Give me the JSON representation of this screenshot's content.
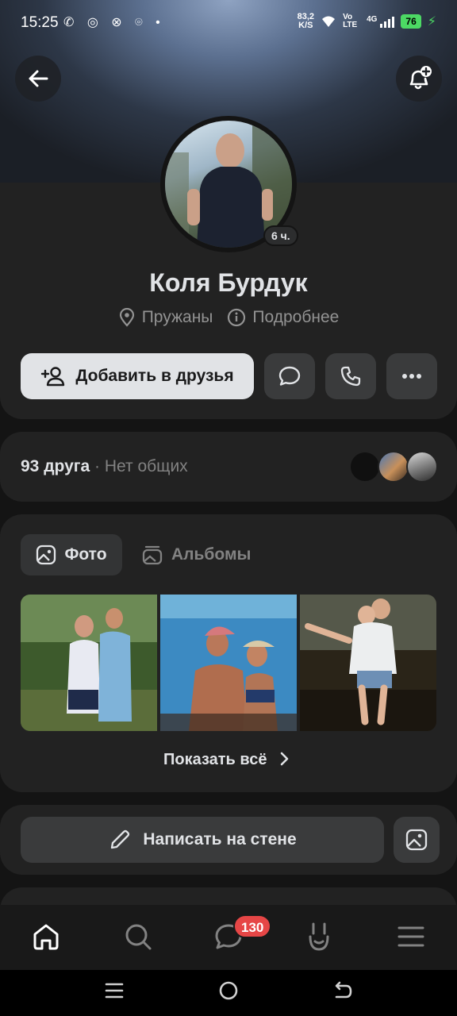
{
  "status_bar": {
    "time": "15:25",
    "speed": "83,2",
    "speed_unit": "K/S",
    "network": "4G",
    "volte": "Vo LTE",
    "battery": "76"
  },
  "profile": {
    "name": "Коля Бурдук",
    "online_badge": "6 ч.",
    "city": "Пружаны",
    "details": "Подробнее"
  },
  "actions": {
    "add_friend": "Добавить в друзья"
  },
  "friends": {
    "count": "93 друга",
    "separator": " · ",
    "mutual": "Нет общих"
  },
  "media": {
    "tabs": [
      {
        "label": "Фото",
        "active": true
      },
      {
        "label": "Альбомы",
        "active": false
      }
    ],
    "show_all": "Показать всё"
  },
  "wall": {
    "write": "Написать на стене"
  },
  "tabbar": {
    "messages_badge": "130"
  },
  "colors": {
    "accent": "#e1e3e6",
    "badge": "#e64646",
    "card": "#222222",
    "background": "#141414"
  }
}
